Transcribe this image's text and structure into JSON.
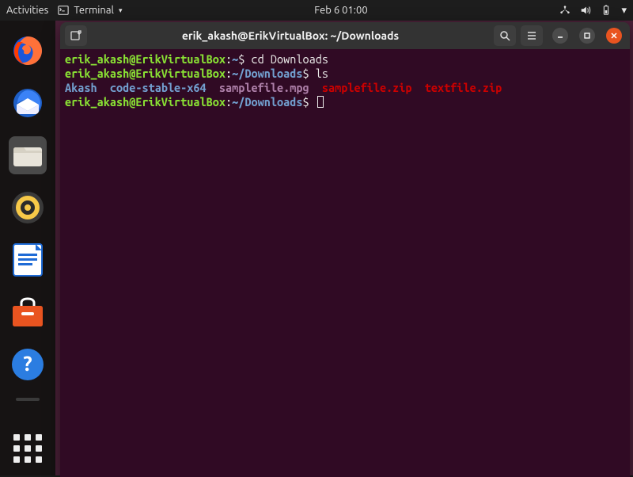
{
  "topbar": {
    "activities": "Activities",
    "app_name": "Terminal",
    "datetime": "Feb 6  01:00"
  },
  "dock": {
    "items": [
      "firefox",
      "thunderbird",
      "files",
      "rhythmbox",
      "libreoffice-writer",
      "ubuntu-software",
      "help"
    ]
  },
  "window": {
    "title": "erik_akash@ErikVirtualBox: ~/Downloads"
  },
  "terminal": {
    "prompt_user": "erik_akash@ErikVirtualBox",
    "lines": [
      {
        "path": "~",
        "cmd": "cd Downloads"
      },
      {
        "path": "~/Downloads",
        "cmd": "ls"
      }
    ],
    "ls_output": {
      "dirs": [
        "Akash",
        "code-stable-x64"
      ],
      "media": [
        "samplefile.mpg"
      ],
      "archives": [
        "samplefile.zip",
        "textfile.zip"
      ]
    },
    "current_prompt_path": "~/Downloads",
    "colon": ":",
    "dollar": "$"
  }
}
